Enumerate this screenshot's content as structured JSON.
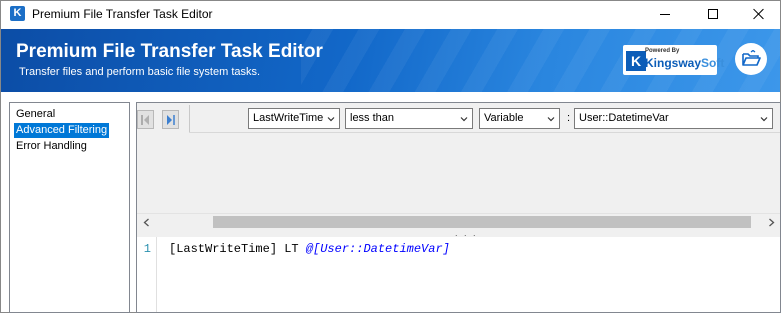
{
  "window": {
    "title": "Premium File Transfer Task Editor",
    "app_icon_letter": "K"
  },
  "banner": {
    "title": "Premium File Transfer Task Editor",
    "subtitle": "Transfer files and perform basic file system tasks.",
    "brand": {
      "powered_by": "Powered By",
      "name_part1": "Kingsway",
      "name_part2": "Soft",
      "logo_letter": "K"
    },
    "folder_icon": "folder-open-icon"
  },
  "nav": {
    "items": [
      {
        "label": "General",
        "selected": false
      },
      {
        "label": "Advanced Filtering",
        "selected": true
      },
      {
        "label": "Error Handling",
        "selected": false
      }
    ]
  },
  "filter_row": {
    "field": "LastWriteTime",
    "operator": "less than",
    "value_type": "Variable",
    "separator": ":",
    "value": "User::DatetimeVar"
  },
  "splitter": {
    "grip": ". . ."
  },
  "editor": {
    "line_number": "1",
    "code_text": "[LastWriteTime] LT ",
    "code_variable": "@[User::DatetimeVar]"
  },
  "colors": {
    "accent": "#0078d7",
    "banner_dark": "#0c4da6",
    "banner_light": "#3c97ea",
    "code_variable": "#0000ff",
    "line_number": "#2b91af"
  }
}
